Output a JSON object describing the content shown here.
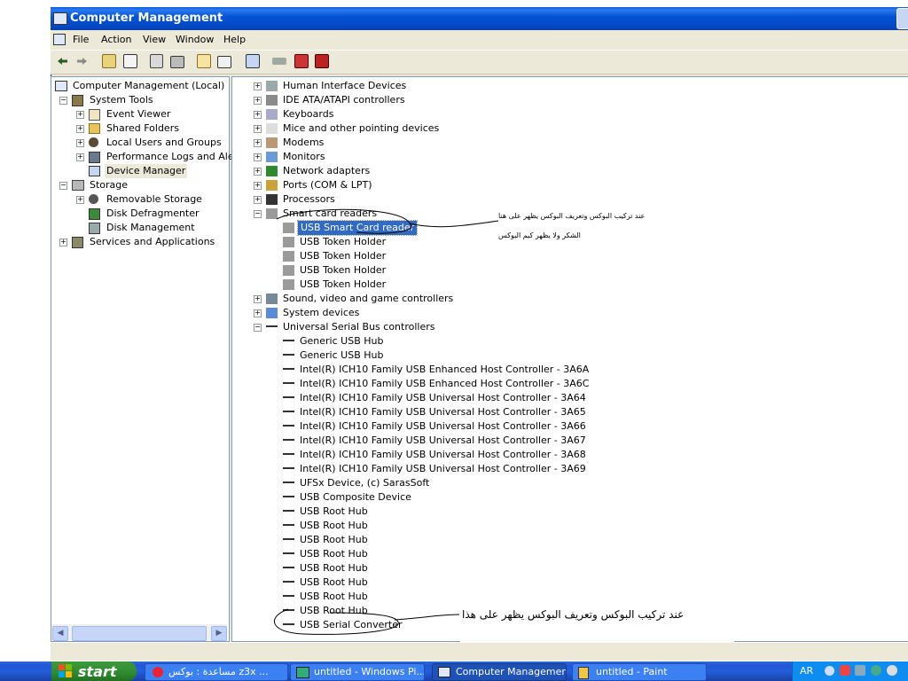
{
  "window": {
    "title": "Computer Management"
  },
  "menu": [
    "File",
    "Action",
    "View",
    "Window",
    "Help"
  ],
  "left_tree": [
    {
      "label": "Computer Management (Local)",
      "icon": "computer-icon"
    },
    {
      "label": "System Tools",
      "icon": "tools-icon"
    },
    {
      "label": "Event Viewer",
      "icon": "event-viewer-icon"
    },
    {
      "label": "Shared Folders",
      "icon": "shared-folder-icon"
    },
    {
      "label": "Local Users and Groups",
      "icon": "users-icon"
    },
    {
      "label": "Performance Logs and Alerts",
      "icon": "performance-icon"
    },
    {
      "label": "Device Manager",
      "icon": "device-manager-icon"
    },
    {
      "label": "Storage",
      "icon": "storage-icon"
    },
    {
      "label": "Removable Storage",
      "icon": "removable-storage-icon"
    },
    {
      "label": "Disk Defragmenter",
      "icon": "defrag-icon"
    },
    {
      "label": "Disk Management",
      "icon": "disk-management-icon"
    },
    {
      "label": "Services and Applications",
      "icon": "services-icon"
    }
  ],
  "device_tree": [
    {
      "label": "Human Interface Devices",
      "icon": "hid-icon"
    },
    {
      "label": "IDE ATA/ATAPI controllers",
      "icon": "ide-icon"
    },
    {
      "label": "Keyboards",
      "icon": "keyboard-icon"
    },
    {
      "label": "Mice and other pointing devices",
      "icon": "mouse-icon"
    },
    {
      "label": "Modems",
      "icon": "modem-icon"
    },
    {
      "label": "Monitors",
      "icon": "monitor-icon"
    },
    {
      "label": "Network adapters",
      "icon": "network-icon"
    },
    {
      "label": "Ports (COM & LPT)",
      "icon": "port-icon"
    },
    {
      "label": "Processors",
      "icon": "processor-icon"
    },
    {
      "label": "Smart card readers",
      "icon": "smart-card-icon"
    },
    {
      "label": "USB Smart Card reader",
      "icon": "smart-card-icon"
    },
    {
      "label": "USB Token Holder",
      "icon": "smart-card-icon"
    },
    {
      "label": "USB Token Holder",
      "icon": "smart-card-icon"
    },
    {
      "label": "USB Token Holder",
      "icon": "smart-card-icon"
    },
    {
      "label": "USB Token Holder",
      "icon": "smart-card-icon"
    },
    {
      "label": "Sound, video and game controllers",
      "icon": "sound-icon"
    },
    {
      "label": "System devices",
      "icon": "system-device-icon"
    },
    {
      "label": "Universal Serial Bus controllers",
      "icon": "usb-icon"
    },
    {
      "label": "Generic USB Hub",
      "icon": "usb-icon"
    },
    {
      "label": "Generic USB Hub",
      "icon": "usb-icon"
    },
    {
      "label": "Intel(R) ICH10 Family USB Enhanced Host Controller - 3A6A",
      "icon": "usb-icon"
    },
    {
      "label": "Intel(R) ICH10 Family USB Enhanced Host Controller - 3A6C",
      "icon": "usb-icon"
    },
    {
      "label": "Intel(R) ICH10 Family USB Universal Host Controller - 3A64",
      "icon": "usb-icon"
    },
    {
      "label": "Intel(R) ICH10 Family USB Universal Host Controller - 3A65",
      "icon": "usb-icon"
    },
    {
      "label": "Intel(R) ICH10 Family USB Universal Host Controller - 3A66",
      "icon": "usb-icon"
    },
    {
      "label": "Intel(R) ICH10 Family USB Universal Host Controller - 3A67",
      "icon": "usb-icon"
    },
    {
      "label": "Intel(R) ICH10 Family USB Universal Host Controller - 3A68",
      "icon": "usb-icon"
    },
    {
      "label": "Intel(R) ICH10 Family USB Universal Host Controller - 3A69",
      "icon": "usb-icon"
    },
    {
      "label": "UFSx Device, (c) SarasSoft",
      "icon": "usb-icon"
    },
    {
      "label": "USB Composite Device",
      "icon": "usb-icon"
    },
    {
      "label": "USB Root Hub",
      "icon": "usb-icon"
    },
    {
      "label": "USB Root Hub",
      "icon": "usb-icon"
    },
    {
      "label": "USB Root Hub",
      "icon": "usb-icon"
    },
    {
      "label": "USB Root Hub",
      "icon": "usb-icon"
    },
    {
      "label": "USB Root Hub",
      "icon": "usb-icon"
    },
    {
      "label": "USB Root Hub",
      "icon": "usb-icon"
    },
    {
      "label": "USB Root Hub",
      "icon": "usb-icon"
    },
    {
      "label": "USB Root Hub",
      "icon": "usb-icon"
    },
    {
      "label": "USB Serial Converter",
      "icon": "usb-icon"
    }
  ],
  "annotations": {
    "note1": "عند تركيب البوكس وتعريف البوكس يظهر على هنا",
    "note2": "الشكر ولا يظهر كيم البوكس",
    "note3": "عند تركيب البوكس وتعريف البوكس يظهر على هذا"
  },
  "taskbar": {
    "start": "start",
    "tasks": [
      "مساعدة : بوكس z3x ...",
      "untitled - Windows Pi...",
      "Computer Management",
      "untitled - Paint"
    ],
    "lang": "AR"
  },
  "colors": {
    "selection": "#316ac5",
    "title_bar": "#0454d6",
    "taskbar": "#245edb",
    "start": "#2f8a2f"
  }
}
